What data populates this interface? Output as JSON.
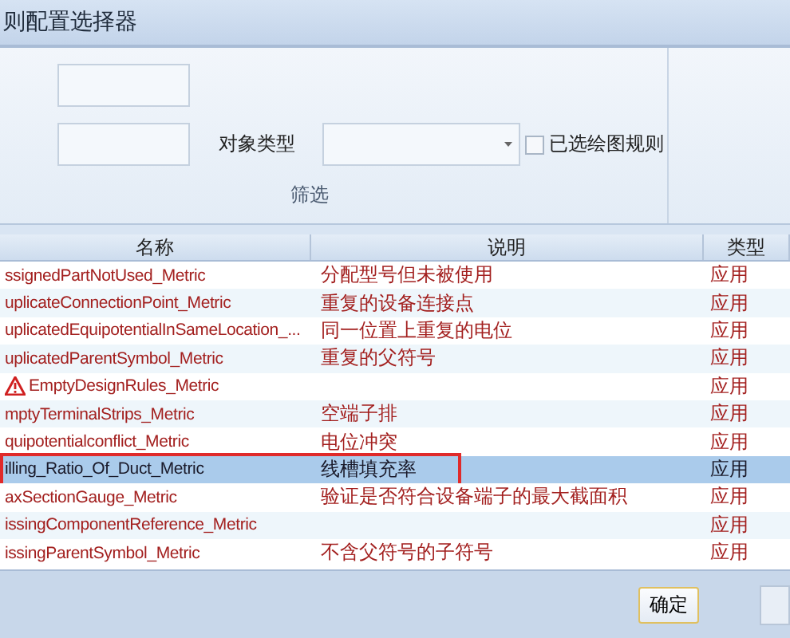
{
  "window": {
    "title": "则配置选择器"
  },
  "filter": {
    "object_type_label": "对象类型",
    "checkbox_label": "已选绘图规则",
    "checked": false,
    "group_label": "筛选"
  },
  "table": {
    "columns": [
      "名称",
      "说明",
      "类型"
    ],
    "rows": [
      {
        "name": "ssignedPartNotUsed_Metric",
        "description": "分配型号但未被使用",
        "type": "应用",
        "warning": false,
        "selected": false,
        "highlighted": false
      },
      {
        "name": "uplicateConnectionPoint_Metric",
        "description": "重复的设备连接点",
        "type": "应用",
        "warning": false,
        "selected": false,
        "highlighted": false
      },
      {
        "name": "uplicatedEquipotentialInSameLocation_...",
        "description": "同一位置上重复的电位",
        "type": "应用",
        "warning": false,
        "selected": false,
        "highlighted": false
      },
      {
        "name": "uplicatedParentSymbol_Metric",
        "description": "重复的父符号",
        "type": "应用",
        "warning": false,
        "selected": false,
        "highlighted": false
      },
      {
        "name": "EmptyDesignRules_Metric",
        "description": "",
        "type": "应用",
        "warning": true,
        "selected": false,
        "highlighted": false
      },
      {
        "name": "mptyTerminalStrips_Metric",
        "description": "空端子排",
        "type": "应用",
        "warning": false,
        "selected": false,
        "highlighted": false
      },
      {
        "name": "quipotentialconflict_Metric",
        "description": "电位冲突",
        "type": "应用",
        "warning": false,
        "selected": false,
        "highlighted": false
      },
      {
        "name": "illing_Ratio_Of_Duct_Metric",
        "description": "线槽填充率",
        "type": "应用",
        "warning": false,
        "selected": true,
        "highlighted": true
      },
      {
        "name": "axSectionGauge_Metric",
        "description": "验证是否符合设备端子的最大截面积",
        "type": "应用",
        "warning": false,
        "selected": false,
        "highlighted": false
      },
      {
        "name": "issingComponentReference_Metric",
        "description": "",
        "type": "应用",
        "warning": false,
        "selected": false,
        "highlighted": false
      },
      {
        "name": "issingParentSymbol_Metric",
        "description": "不含父符号的子符号",
        "type": "应用",
        "warning": false,
        "selected": false,
        "highlighted": false
      }
    ]
  },
  "buttons": [
    "确定"
  ]
}
